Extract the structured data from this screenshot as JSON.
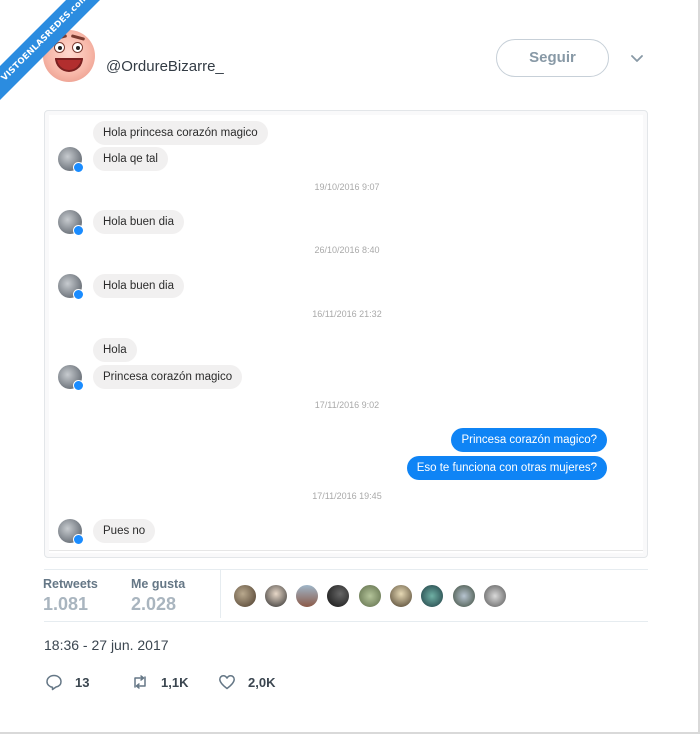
{
  "watermark": {
    "text": "VISTOENLASREDES.com"
  },
  "header": {
    "handle": "@OrdureBizarre_",
    "follow_label": "Seguir"
  },
  "chat": {
    "items": [
      {
        "kind": "in",
        "text": "Hola princesa corazón magico"
      },
      {
        "kind": "in",
        "text": "Hola qe tal"
      },
      {
        "kind": "stamp",
        "text": "19/10/2016 9:07"
      },
      {
        "kind": "in",
        "text": "Hola buen dia"
      },
      {
        "kind": "stamp",
        "text": "26/10/2016 8:40"
      },
      {
        "kind": "in",
        "text": "Hola buen dia"
      },
      {
        "kind": "stamp",
        "text": "16/11/2016 21:32"
      },
      {
        "kind": "in",
        "text": "Hola"
      },
      {
        "kind": "in",
        "text": "Princesa corazón magico"
      },
      {
        "kind": "stamp",
        "text": "17/11/2016 9:02"
      },
      {
        "kind": "out",
        "text": "Princesa corazón magico?"
      },
      {
        "kind": "out",
        "text": "Eso te funciona con otras mujeres?"
      },
      {
        "kind": "stamp",
        "text": "17/11/2016 19:45"
      },
      {
        "kind": "in",
        "text": "Pues no"
      }
    ],
    "colors": {
      "outgoing": "#0f84f5",
      "incoming": "#f1f0f0"
    }
  },
  "stats": {
    "retweets_label": "Retweets",
    "retweets_value": "1.081",
    "likes_label": "Me gusta",
    "likes_value": "2.028",
    "liker_count": 9
  },
  "timestamp": "18:36 - 27 jun. 2017",
  "actions": {
    "reply_count": "13",
    "retweet_count": "1,1K",
    "like_count": "2,0K"
  }
}
